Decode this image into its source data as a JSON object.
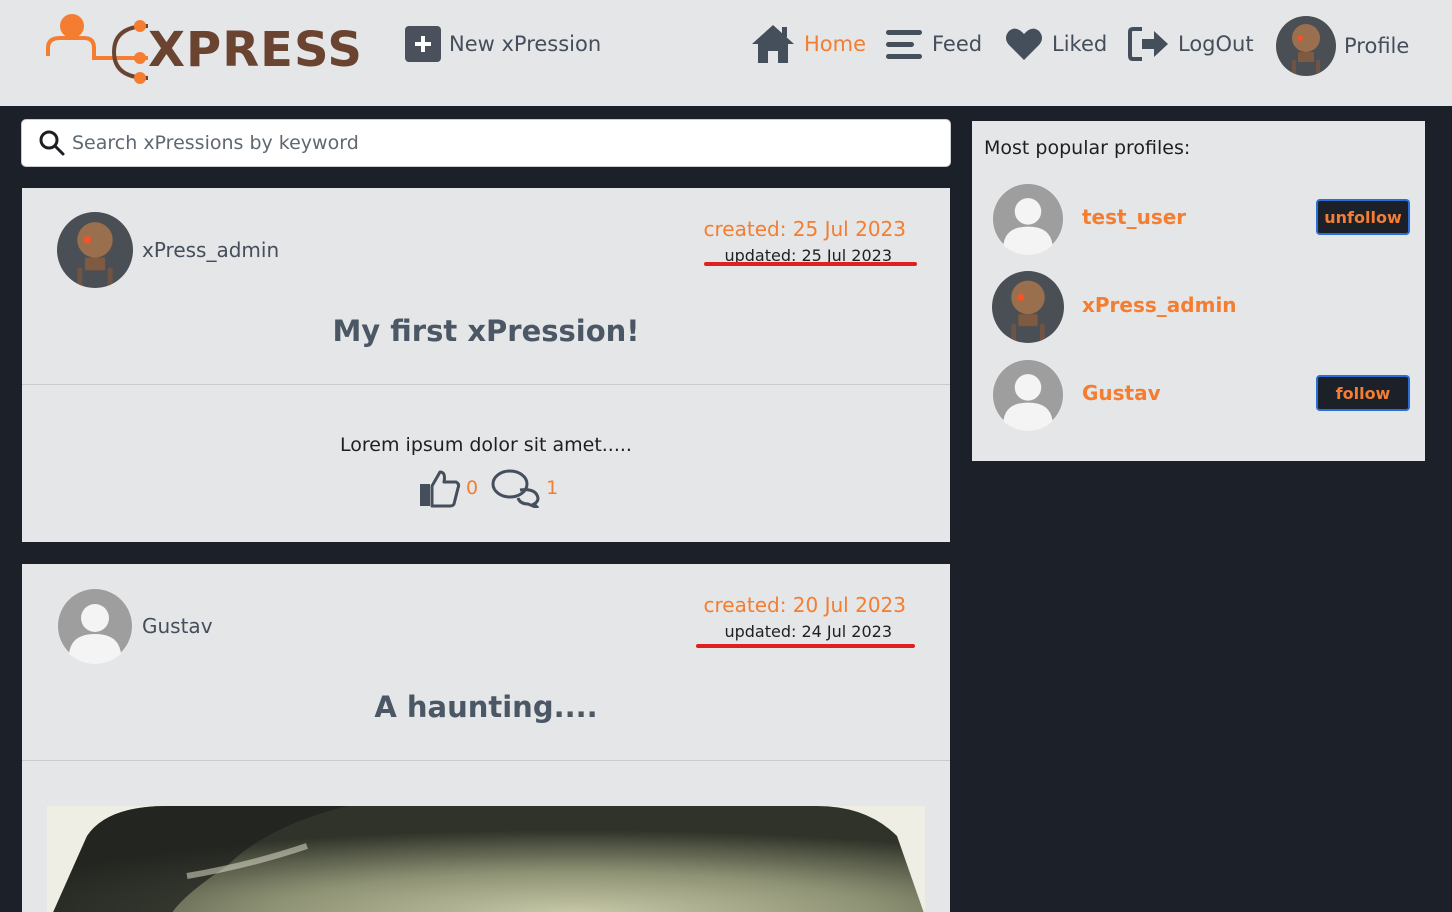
{
  "app": {
    "logo_text": "XPRESS",
    "accent_color": "#f47d31",
    "dark_color": "#1b2029"
  },
  "header": {
    "new_button_label": "New xPression",
    "nav": [
      {
        "label": "Home",
        "icon": "home-icon",
        "active": true
      },
      {
        "label": "Feed",
        "icon": "menu-icon",
        "active": false
      },
      {
        "label": "Liked",
        "icon": "heart-icon",
        "active": false
      },
      {
        "label": "LogOut",
        "icon": "logout-icon",
        "active": false
      },
      {
        "label": "Profile",
        "icon": "avatar",
        "active": false
      }
    ]
  },
  "search": {
    "placeholder": "Search xPressions by keyword",
    "value": ""
  },
  "posts": [
    {
      "author": "xPress_admin",
      "created": "created: 25 Jul 2023",
      "updated": "updated: 25 Jul 2023",
      "title": "My first xPression!",
      "body": "Lorem ipsum dolor sit amet.....",
      "likes": "0",
      "comments": "1"
    },
    {
      "author": "Gustav",
      "created": "created: 20 Jul 2023",
      "updated": "updated: 24 Jul 2023",
      "title": "A haunting...."
    }
  ],
  "sidebar": {
    "title": "Most popular profiles:",
    "profiles": [
      {
        "name": "test_user",
        "button": "unfollow"
      },
      {
        "name": "xPress_admin",
        "button": ""
      },
      {
        "name": "Gustav",
        "button": "follow"
      }
    ]
  }
}
